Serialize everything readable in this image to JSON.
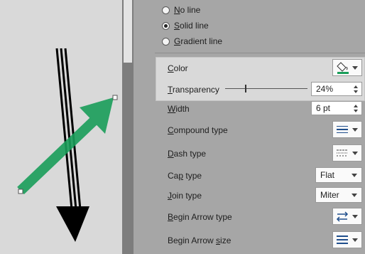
{
  "line_fill": {
    "no_line": {
      "hotkey": "N",
      "rest": "o line",
      "selected": false
    },
    "solid_line": {
      "hotkey": "S",
      "rest": "olid line",
      "selected": true
    },
    "gradient_line": {
      "hotkey": "G",
      "rest": "radient line",
      "selected": false
    }
  },
  "color": {
    "hotkey": "C",
    "rest": "olor",
    "swatch": "#1a9e5a"
  },
  "transparency": {
    "hotkey": "T",
    "rest": "ransparency",
    "value": "24%",
    "level": 0.24
  },
  "width": {
    "hotkey": "W",
    "rest": "idth",
    "value": "6 pt"
  },
  "compound_type": {
    "hotkey": "C",
    "rest": "ompound type"
  },
  "dash_type": {
    "hotkey": "D",
    "rest": "ash type"
  },
  "cap_type": {
    "pre": "Ca",
    "hotkey": "p",
    "rest": " type",
    "value": "Flat"
  },
  "join_type": {
    "hotkey": "J",
    "rest": "oin type",
    "value": "Miter"
  },
  "begin_arrow_type": {
    "hotkey": "B",
    "rest": "egin Arrow type"
  },
  "begin_arrow_size": {
    "pre": "Begin Arrow ",
    "hotkey": "s",
    "rest": "ize"
  },
  "colors": {
    "arrow_green": "#1a9e5a",
    "arrow_black": "#000000"
  }
}
